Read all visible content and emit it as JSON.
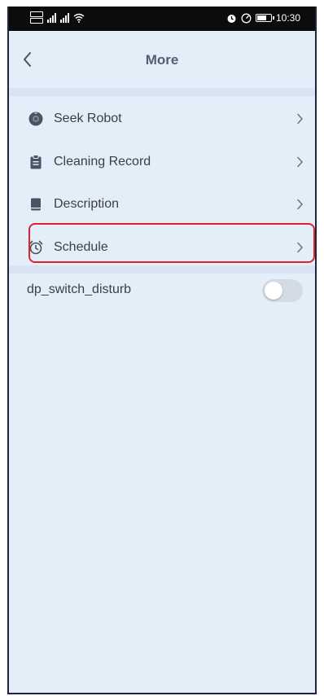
{
  "status_bar": {
    "time": "10:30",
    "battery_level": 0.75,
    "icons": [
      "sim-icon",
      "signal-icon",
      "signal-icon",
      "wifi-icon",
      "alarm-icon",
      "speed-icon",
      "battery-icon"
    ]
  },
  "header": {
    "title": "More",
    "back_icon": "chevron-left-icon"
  },
  "menu": {
    "items": [
      {
        "label": "Seek Robot",
        "icon": "robot-icon"
      },
      {
        "label": "Cleaning Record",
        "icon": "clipboard-icon"
      },
      {
        "label": "Description",
        "icon": "book-icon"
      },
      {
        "label": "Schedule",
        "icon": "alarm-clock-icon",
        "highlighted": true
      }
    ]
  },
  "settings": {
    "switch_label": "dp_switch_disturb",
    "switch_on": false
  },
  "colors": {
    "background": "#e4eef9",
    "text": "#3a3f47",
    "title": "#555e6d",
    "highlight": "#e0202a",
    "toggle_off": "#d3dbe5"
  }
}
